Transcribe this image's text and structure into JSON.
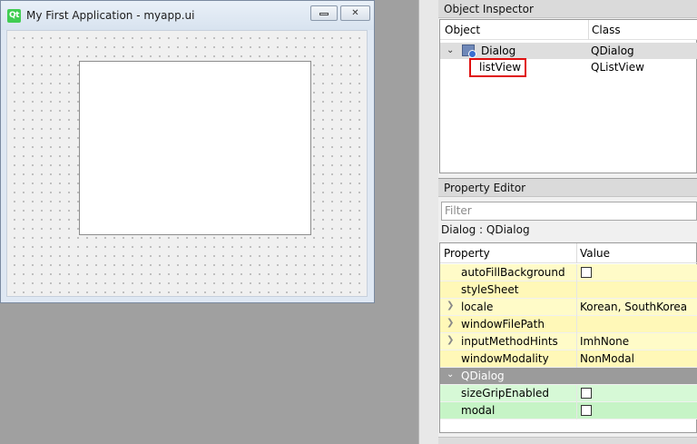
{
  "form_window": {
    "title": "My First Application - myapp.ui",
    "logo_text": "Qt",
    "close_glyph": "✕"
  },
  "object_inspector": {
    "title": "Object Inspector",
    "columns": [
      "Object",
      "Class"
    ],
    "rows": [
      {
        "object": "Dialog",
        "class": "QDialog",
        "expanded": true,
        "selected": true
      },
      {
        "object": "listView",
        "class": "QListView",
        "highlighted": true
      }
    ],
    "highlight_color": "#e01010"
  },
  "property_editor": {
    "title": "Property Editor",
    "filter_placeholder": "Filter",
    "class_line": "Dialog : QDialog",
    "columns": [
      "Property",
      "Value"
    ],
    "rows": [
      {
        "name": "autoFillBackground",
        "value": "",
        "checkbox": true,
        "expander": false,
        "color": "yellow"
      },
      {
        "name": "styleSheet",
        "value": "",
        "checkbox": false,
        "expander": false,
        "color": "yellow2"
      },
      {
        "name": "locale",
        "value": "Korean, SouthKorea",
        "checkbox": false,
        "expander": true,
        "color": "yellow"
      },
      {
        "name": "windowFilePath",
        "value": "",
        "checkbox": false,
        "expander": true,
        "color": "yellow2"
      },
      {
        "name": "inputMethodHints",
        "value": "ImhNone",
        "checkbox": false,
        "expander": true,
        "color": "yellow"
      },
      {
        "name": "windowModality",
        "value": "NonModal",
        "checkbox": false,
        "expander": false,
        "color": "yellow2"
      },
      {
        "name": "QDialog",
        "value": "",
        "group": true,
        "color": "group"
      },
      {
        "name": "sizeGripEnabled",
        "value": "",
        "checkbox": true,
        "expander": false,
        "color": "green"
      },
      {
        "name": "modal",
        "value": "",
        "checkbox": true,
        "expander": false,
        "color": "green2"
      }
    ]
  },
  "icons": {
    "expand": "chevron-right-icon",
    "collapse": "chevron-down-icon"
  }
}
